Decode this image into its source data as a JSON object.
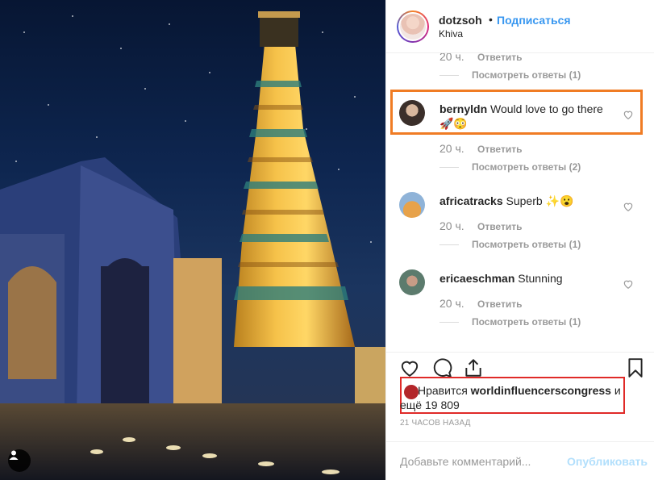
{
  "photo": {
    "alt_icon": "user-tag-icon"
  },
  "header": {
    "username": "dotzsoh",
    "separator": "•",
    "follow_label": "Подписаться",
    "location": "Khiva"
  },
  "comments": {
    "top_meta": {
      "time": "20 ч.",
      "reply": "Ответить",
      "view_replies": "Посмотреть ответы (1)"
    },
    "items": [
      {
        "user": "bernyldn",
        "text": "Would love to go there 🚀😳",
        "time": "20 ч.",
        "reply": "Ответить",
        "view_replies": "Посмотреть ответы (2)"
      },
      {
        "user": "africatracks",
        "text": "Superb ✨😮",
        "time": "20 ч.",
        "reply": "Ответить",
        "view_replies": "Посмотреть ответы (1)"
      },
      {
        "user": "ericaeschman",
        "text": "Stunning",
        "time": "20 ч.",
        "reply": "Ответить",
        "view_replies": "Посмотреть ответы (1)"
      }
    ]
  },
  "likes": {
    "prefix": "Нравится",
    "user": "worldinfluencerscongress",
    "suffix": "и",
    "more": "ещё 19 809"
  },
  "time_ago": "21 ЧАСОВ НАЗАД",
  "add_comment": {
    "placeholder": "Добавьте комментарий...",
    "publish_label": "Опубликовать"
  },
  "colors": {
    "link": "#3897f0",
    "highlight_orange": "#f07c24",
    "highlight_red": "#e02a28",
    "publish_disabled": "#b2dffc"
  }
}
